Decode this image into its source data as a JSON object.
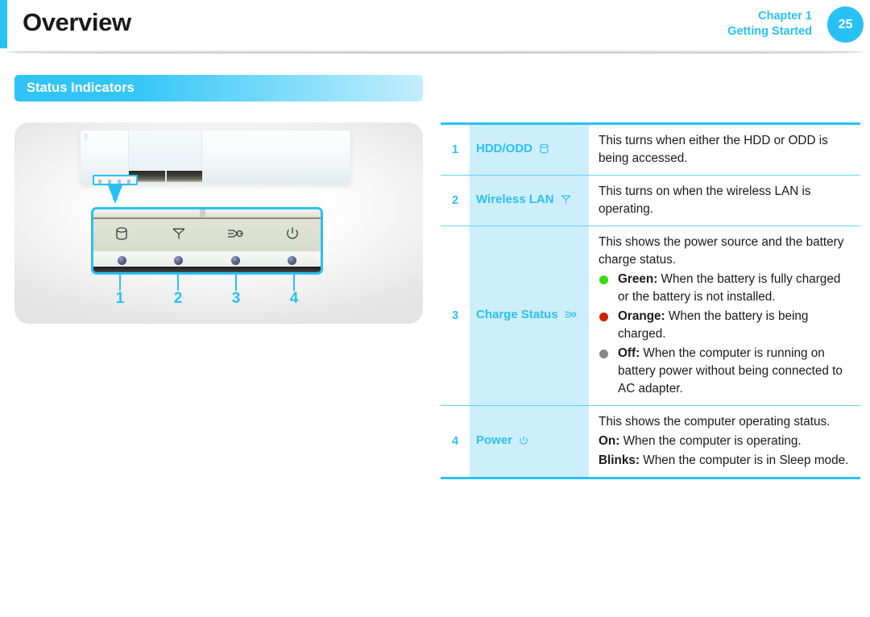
{
  "header": {
    "title": "Overview",
    "chapter": "Chapter 1",
    "chapter_section": "Getting Started",
    "page_number": "25",
    "accent_color": "#29c1f5"
  },
  "section": {
    "title": "Status Indicators"
  },
  "illustration": {
    "alt": "Laptop front edge showing status indicator LEDs",
    "callout_numbers": [
      "1",
      "2",
      "3",
      "4"
    ],
    "indicator_icons": [
      "hdd-icon",
      "wireless-lan-icon",
      "charge-status-icon",
      "power-icon"
    ]
  },
  "table": {
    "rows": [
      {
        "num": "1",
        "label": "HDD/ODD",
        "icon": "hdd-icon",
        "description": "This turns when either the HDD or ODD is being accessed.",
        "bullets": []
      },
      {
        "num": "2",
        "label": "Wireless LAN",
        "icon": "wireless-lan-icon",
        "description": "This turns on when the wireless LAN is operating.",
        "bullets": []
      },
      {
        "num": "3",
        "label": "Charge Status",
        "icon": "charge-status-icon",
        "description": "This shows the power source and the battery charge status.",
        "bullets": [
          {
            "color": "#33dd11",
            "color_name": "green-bullet",
            "term": "Green:",
            "text": " When the battery is fully charged or the battery is not installed."
          },
          {
            "color": "#c92200",
            "color_name": "orange-bullet",
            "term": "Orange:",
            "text": " When the battery is being charged."
          },
          {
            "color": "#878787",
            "color_name": "off-bullet",
            "term": "Off:",
            "text": " When the computer is running on battery power without being connected to AC adapter."
          }
        ]
      },
      {
        "num": "4",
        "label": "Power",
        "icon": "power-icon",
        "description": "This shows the computer operating status.",
        "bullets": [
          {
            "color": "",
            "color_name": "no-bullet",
            "term": "On:",
            "text": " When the computer is operating."
          },
          {
            "color": "",
            "color_name": "no-bullet",
            "term": "Blinks:",
            "text": " When the computer is in Sleep mode."
          }
        ]
      }
    ]
  }
}
